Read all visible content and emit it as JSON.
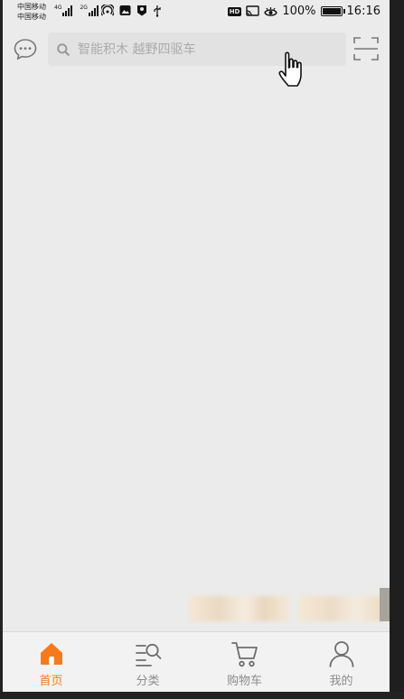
{
  "status_bar": {
    "carrier_line1": "中国移动",
    "carrier_line2": "中国移动",
    "net1": "4G",
    "net2": "2G",
    "hd": "HD",
    "battery": "100%",
    "battery_level": 1.0,
    "time": "16:16"
  },
  "header": {
    "search_placeholder": "智能积木 越野四驱车",
    "icons": {
      "left": "message-icon",
      "right": "scan-icon"
    }
  },
  "tabs": [
    {
      "label": "首页",
      "icon": "home-icon",
      "active": true
    },
    {
      "label": "分类",
      "icon": "category-search-icon",
      "active": false
    },
    {
      "label": "购物车",
      "icon": "cart-icon",
      "active": false
    },
    {
      "label": "我的",
      "icon": "profile-icon",
      "active": false
    }
  ],
  "colors": {
    "accent": "#f37b1d",
    "background": "#ebebeb",
    "tab_inactive": "#8c8c8c"
  }
}
